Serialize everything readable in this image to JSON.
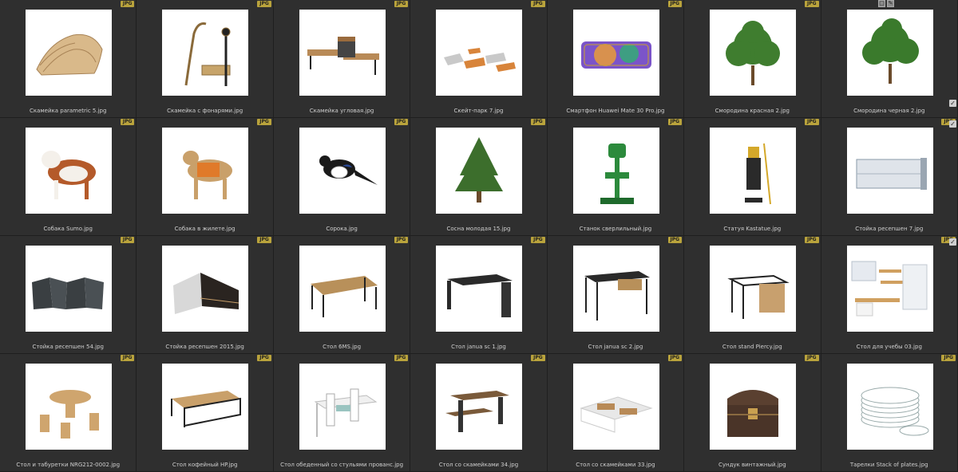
{
  "badge_label": "JPG",
  "toolbar": {
    "stack_icon": "stack-icon",
    "edit_icon": "pencil-icon"
  },
  "items": [
    {
      "name": "Скамейка parametric 5.jpg",
      "icon": "parametric-bench"
    },
    {
      "name": "Скамейка с фонарями.jpg",
      "icon": "bench-with-lamps"
    },
    {
      "name": "Скамейка угловая.jpg",
      "icon": "corner-bench"
    },
    {
      "name": "Скейт-парк 7.jpg",
      "icon": "skate-park"
    },
    {
      "name": "Смартфон Huawei Mate 30 Pro.jpg",
      "icon": "smartphone"
    },
    {
      "name": "Смородина красная 2.jpg",
      "icon": "red-currant-bush"
    },
    {
      "name": "Смородина черная 2.jpg",
      "icon": "black-currant-bush"
    },
    {
      "name": "Собака Sumo.jpg",
      "icon": "dog-sumo"
    },
    {
      "name": "Собака в жилете.jpg",
      "icon": "dog-in-vest"
    },
    {
      "name": "Сорока.jpg",
      "icon": "magpie"
    },
    {
      "name": "Сосна молодая 15.jpg",
      "icon": "young-pine"
    },
    {
      "name": "Станок сверлильный.jpg",
      "icon": "drill-press"
    },
    {
      "name": "Статуя Kastatue.jpg",
      "icon": "statue"
    },
    {
      "name": "Стойка ресепшен 7.jpg",
      "icon": "reception-desk-7"
    },
    {
      "name": "Стойка ресепшен 54.jpg",
      "icon": "reception-desk-54"
    },
    {
      "name": "Стойка ресепшен 2015.jpg",
      "icon": "reception-desk-2015"
    },
    {
      "name": "Стол 6MS.jpg",
      "icon": "table-6ms"
    },
    {
      "name": "Стол janua sc 1.jpg",
      "icon": "janua-table-1"
    },
    {
      "name": "Стол janua sc 2.jpg",
      "icon": "janua-table-2"
    },
    {
      "name": "Стол stand Piercy.jpg",
      "icon": "stand-desk"
    },
    {
      "name": "Стол для учебы 03.jpg",
      "icon": "study-desk"
    },
    {
      "name": "Стол и табуретки NRG212-0002.jpg",
      "icon": "table-and-stools"
    },
    {
      "name": "Стол кофейный HP.jpg",
      "icon": "coffee-table"
    },
    {
      "name": "Стол обеденный со стульями прованс.jpg",
      "icon": "dining-table-chairs"
    },
    {
      "name": "Стол со скамейками 34.jpg",
      "icon": "table-benches-34"
    },
    {
      "name": "Стол со скамейками 33.jpg",
      "icon": "table-benches-33"
    },
    {
      "name": "Сундук винтажный.jpg",
      "icon": "vintage-chest"
    },
    {
      "name": "Тарелки Stack of plates.jpg",
      "icon": "plates-stack"
    }
  ],
  "colors": {
    "background": "#2b2b2b",
    "badge": "#b9a33c",
    "label": "#cfcfcf"
  }
}
